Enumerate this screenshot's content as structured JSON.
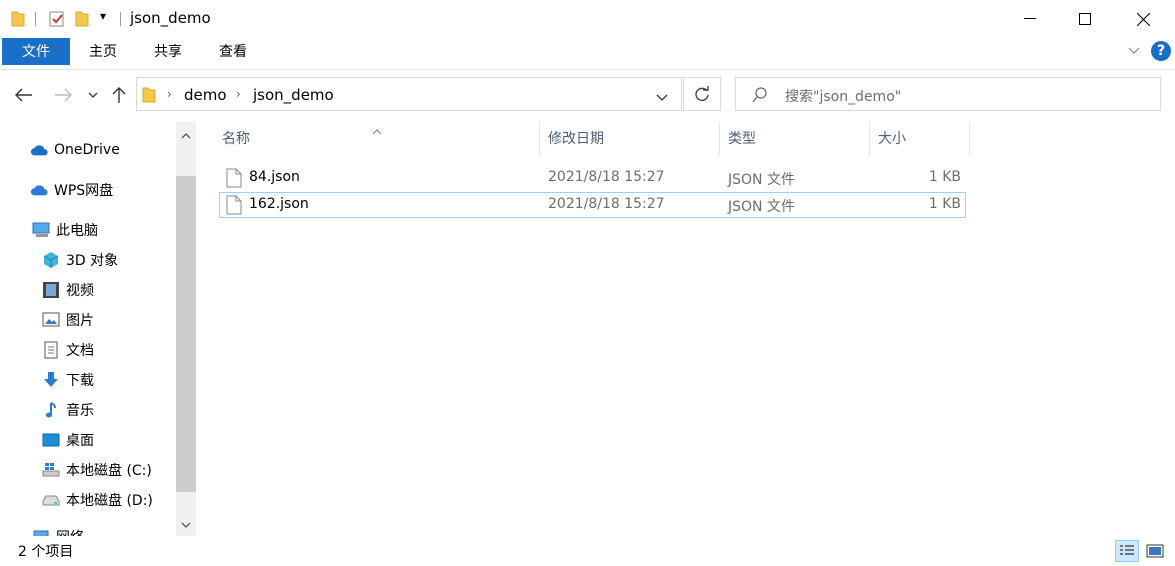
{
  "window": {
    "title": "json_demo",
    "qa_dropdown": "▾",
    "controls": {
      "minimize": "—",
      "maximize": "☐",
      "close": "✕"
    }
  },
  "ribbon": {
    "tabs": [
      "文件",
      "主页",
      "共享",
      "查看"
    ],
    "help": "?",
    "collapse": "⌄"
  },
  "nav": {
    "back": "←",
    "forward": "→",
    "recent": "⌄",
    "up": "↑",
    "breadcrumb": [
      "demo",
      "json_demo"
    ],
    "crumb_sep": "›",
    "address_dropdown": "⌄",
    "refresh": "↻",
    "search_placeholder": "搜索\"json_demo\""
  },
  "sidebar": {
    "items": [
      {
        "label": "OneDrive",
        "icon": "cloud-icon"
      },
      {
        "label": "WPS网盘",
        "icon": "cloud-icon"
      },
      {
        "label": "此电脑",
        "icon": "computer-icon"
      },
      {
        "label": "3D 对象",
        "icon": "cube-icon"
      },
      {
        "label": "视频",
        "icon": "film-icon"
      },
      {
        "label": "图片",
        "icon": "picture-icon"
      },
      {
        "label": "文档",
        "icon": "document-icon"
      },
      {
        "label": "下载",
        "icon": "download-icon"
      },
      {
        "label": "音乐",
        "icon": "music-icon"
      },
      {
        "label": "桌面",
        "icon": "desktop-icon"
      },
      {
        "label": "本地磁盘 (C:)",
        "icon": "drive-c-icon"
      },
      {
        "label": "本地磁盘 (D:)",
        "icon": "drive-icon"
      },
      {
        "label": "网络",
        "icon": "network-icon"
      }
    ]
  },
  "columns": {
    "name": "名称",
    "date": "修改日期",
    "type": "类型",
    "size": "大小"
  },
  "files": [
    {
      "name": "84.json",
      "date": "2021/8/18 15:27",
      "type": "JSON 文件",
      "size": "1 KB"
    },
    {
      "name": "162.json",
      "date": "2021/8/18 15:27",
      "type": "JSON 文件",
      "size": "1 KB"
    }
  ],
  "status": {
    "count": "2 个项目"
  },
  "colors": {
    "accent": "#1a6fc9",
    "selection_border": "#99d1ff",
    "header_text": "#4c607a"
  }
}
